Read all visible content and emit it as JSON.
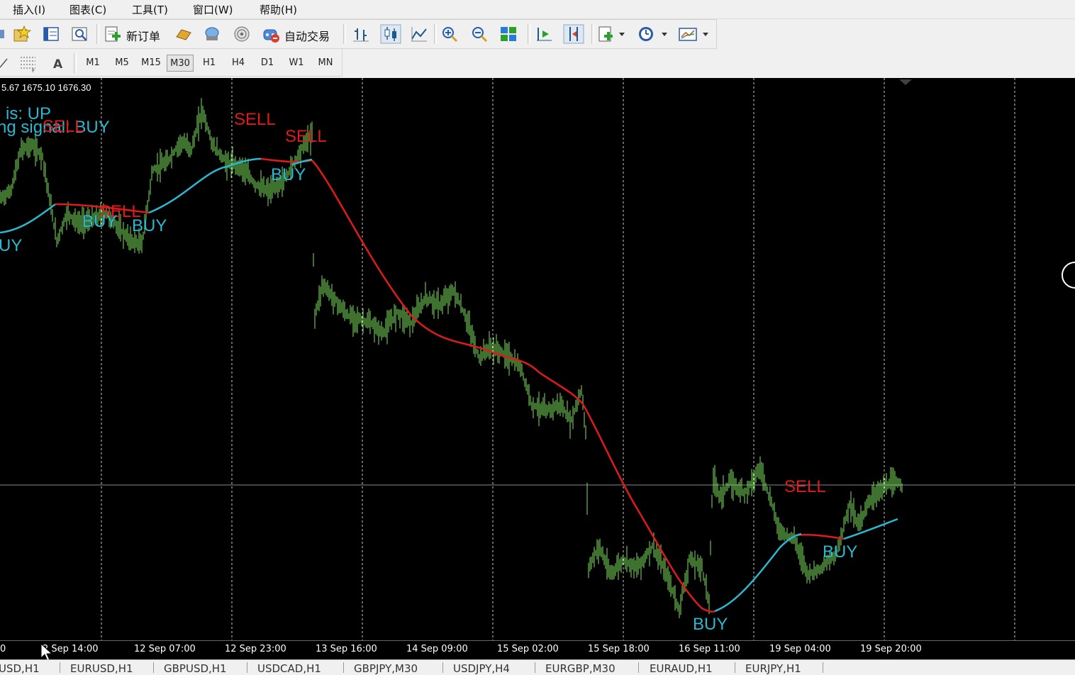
{
  "menu": [
    "插入(I)",
    "图表(C)",
    "工具(T)",
    "窗口(W)",
    "帮助(H)"
  ],
  "toolbar": {
    "new_order": "新订单",
    "auto_trading": "自动交易"
  },
  "periods": [
    "M1",
    "M5",
    "M15",
    "M30",
    "H1",
    "H4",
    "D1",
    "W1",
    "MN"
  ],
  "active_period": "M30",
  "chart": {
    "ohlc_readout": "5.67 1675.10 1676.30",
    "trend_text": "is: UP",
    "signal_text": "ng signal: BUY",
    "time_labels": [
      "0",
      "2 Sep 14:00",
      "12 Sep 07:00",
      "12 Sep 23:00",
      "13 Sep 16:00",
      "14 Sep 09:00",
      "15 Sep 02:00",
      "15 Sep 18:00",
      "16 Sep 11:00",
      "19 Sep 04:00",
      "19 Sep 20:00"
    ],
    "signals": [
      {
        "text": "SELL",
        "type": "sell"
      },
      {
        "text": "SELL",
        "type": "sell"
      },
      {
        "text": "BUY",
        "type": "buy"
      },
      {
        "text": "SELL",
        "type": "sell"
      },
      {
        "text": "BUY",
        "type": "buy"
      },
      {
        "text": "BUY",
        "type": "buy"
      },
      {
        "text": "UY",
        "type": "buy"
      },
      {
        "text": "SELL",
        "type": "sell"
      },
      {
        "text": "BUY",
        "type": "buy"
      },
      {
        "text": "BUY",
        "type": "buy"
      }
    ],
    "colors": {
      "candle": "#7ee35c",
      "ma_up": "#2ab8d0",
      "ma_down": "#e01a1a",
      "sell": "#e01a1a",
      "buy": "#2ab8d0",
      "grid": "#c8c8c8",
      "background": "#000000"
    }
  },
  "tabs": [
    "USD,H1",
    "EURUSD,H1",
    "GBPUSD,H1",
    "USDCAD,H1",
    "GBPJPY,M30",
    "USDJPY,H4",
    "EURGBP,M30",
    "EURAUD,H1",
    "EURJPY,H1"
  ]
}
